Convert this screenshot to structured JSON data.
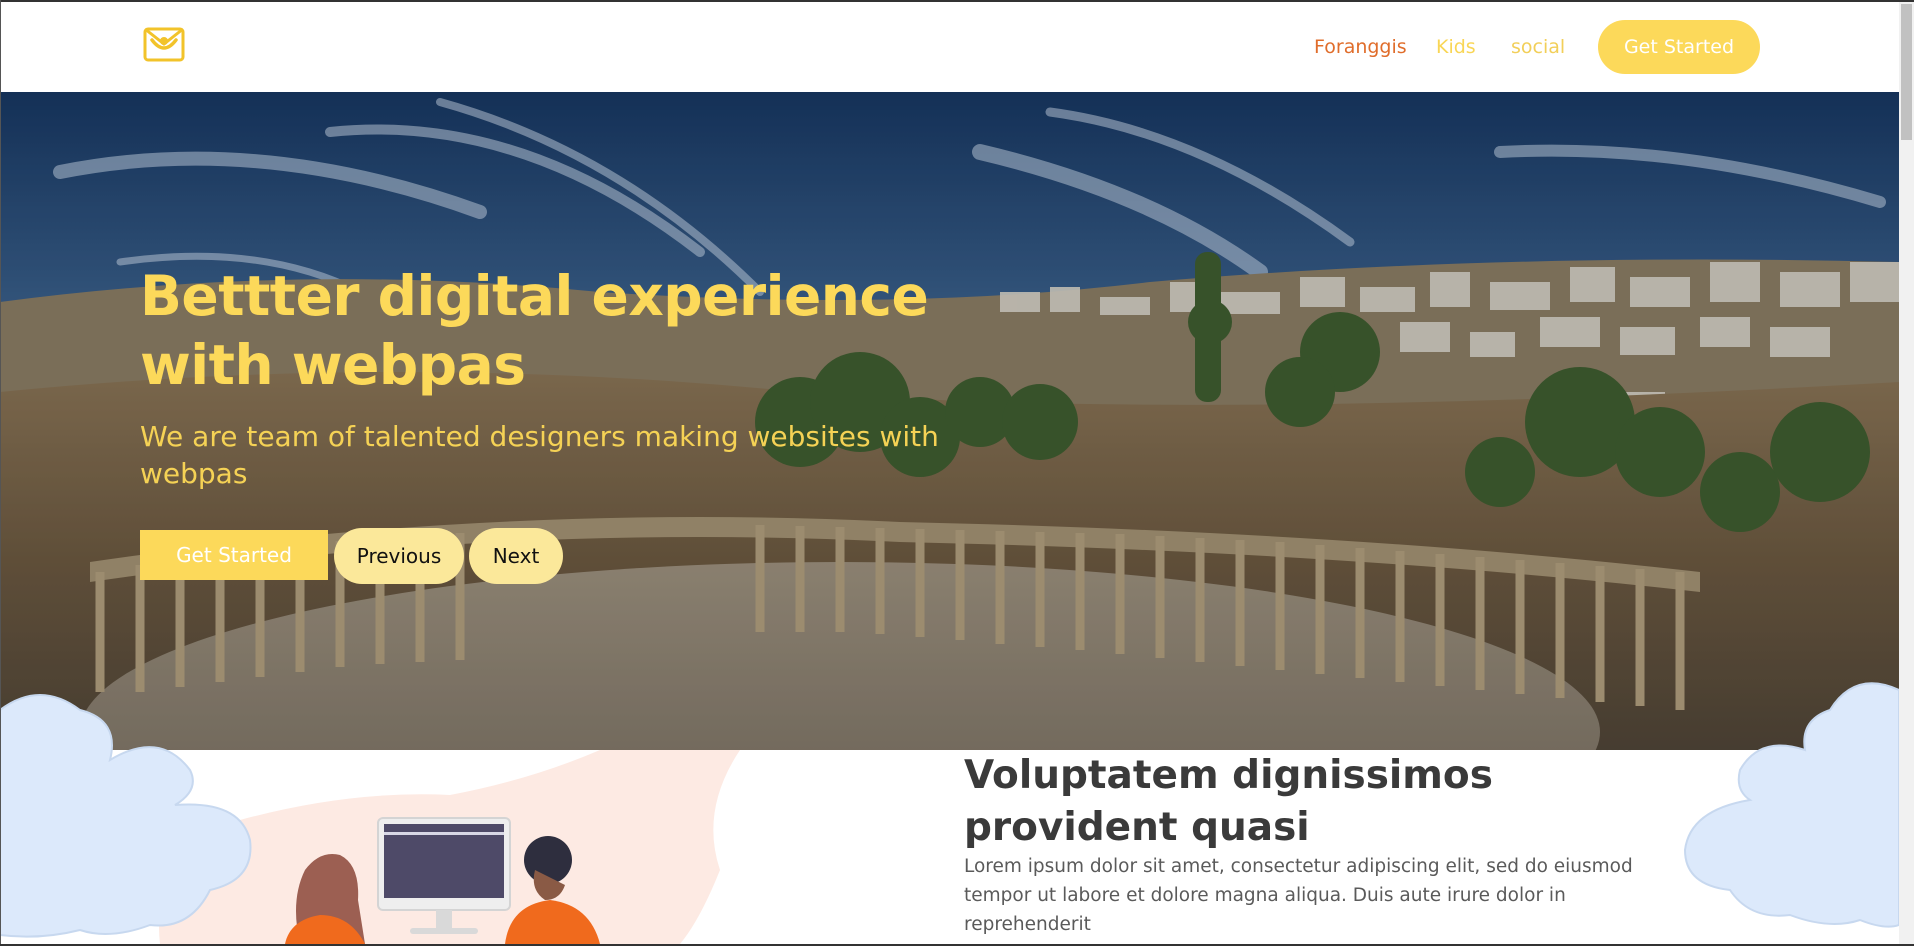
{
  "header": {
    "logo_icon": "smile-envelope-logo",
    "nav": [
      {
        "label": "Foranggis",
        "color": "#e06d2b"
      },
      {
        "label": "Kids",
        "color": "#f9d656"
      },
      {
        "label": "social",
        "color": "#f2cf59"
      }
    ],
    "cta_label": "Get Started"
  },
  "hero": {
    "title": "Bettter digital experience with webpas",
    "subtitle": "We are team of talented designers making websites with webpas",
    "buttons": {
      "primary": "Get Started",
      "previous": "Previous",
      "next": "Next"
    },
    "accent_color": "#fcd95a"
  },
  "about": {
    "title": "Voluptatem dignissimos provident quasi",
    "text": "Lorem ipsum dolor sit amet, consectetur adipiscing elit, sed do eiusmod tempor ut labore et dolore magna aliqua. Duis aute irure dolor in reprehenderit"
  },
  "colors": {
    "brand": "#fcd95a",
    "nav_active": "#e06d2b",
    "cloud": "#dce9fb",
    "blob": "#fdeae3"
  }
}
